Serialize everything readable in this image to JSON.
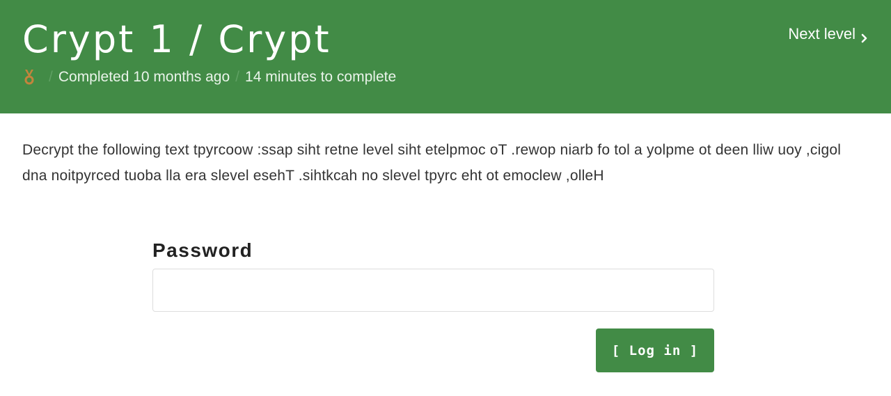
{
  "header": {
    "title": "Crypt 1 / Crypt",
    "status": "Completed 10 months ago",
    "duration": "14 minutes to complete",
    "separator": "/",
    "next_level_label": "Next level",
    "medal_icon": "medal-icon",
    "chevron_icon": "chevron-right-icon"
  },
  "content": {
    "description": "Decrypt the following text tpyrcoow :ssap siht retne level siht etelpmoc oT .rewop niarb fo tol a yolpme ot deen lliw uoy ,cigol dna noitpyrced tuoba lla era slevel esehT .sihtkcah no slevel tpyrc eht ot emoclew ,olleH"
  },
  "form": {
    "password_label": "Password",
    "password_value": "",
    "login_label": "[ Log in ]"
  },
  "colors": {
    "brand_green": "#428b46",
    "medal_bronze": "#c4843c"
  }
}
